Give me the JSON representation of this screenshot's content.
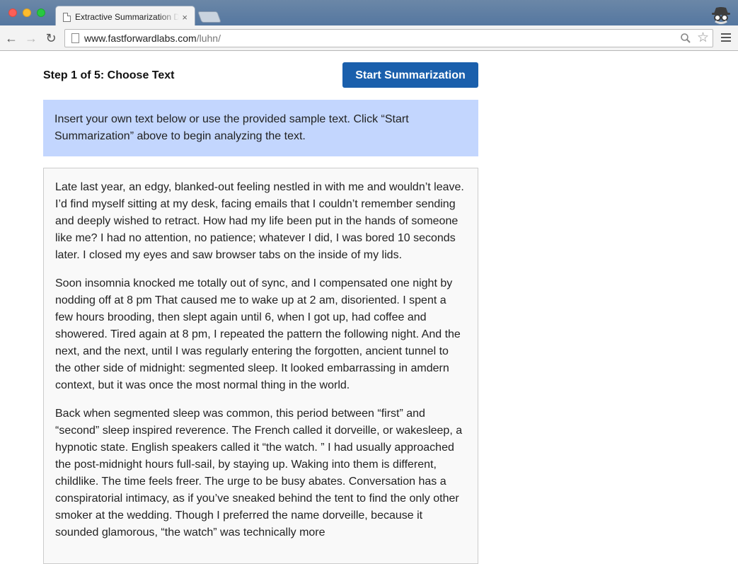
{
  "browser": {
    "tab_title": "Extractive Summarization D",
    "tab_close": "×",
    "url_domain": "www.fastforwardlabs.com",
    "url_path": "/luhn/",
    "back_glyph": "←",
    "forward_glyph": "→",
    "reload_glyph": "↻",
    "star_glyph": "☆"
  },
  "header": {
    "step_title": "Step 1 of 5: Choose Text",
    "start_button": "Start Summarization"
  },
  "info": {
    "text": "Insert your own text below or use the provided sample text. Click “Start Summarization” above to begin analyzing the text."
  },
  "sample_text": {
    "paragraphs": [
      "Late last year, an edgy, blanked-out feeling nestled in with me and wouldn’t leave. I’d find myself sitting at my desk, facing emails that I couldn’t remember sending and deeply wished to retract. How had my life been put in the hands of someone like me? I had no attention, no patience; whatever I did, I was bored 10 seconds later. I closed my eyes and saw browser tabs on the inside of my lids.",
      "Soon insomnia knocked me totally out of sync, and I compensated one night by nodding off at 8 pm That caused me to wake up at 2 am, disoriented. I spent a few hours brooding, then slept again until 6, when I got up, had coffee and showered. Tired again at 8 pm, I repeated the pattern the following night. And the next, and the next, until I was regularly entering the forgotten, ancient tunnel to the other side of midnight: segmented sleep. It looked embarrassing in amdern context, but it was once the most normal thing in the world.",
      "Back when segmented sleep was common, this period between “first” and “second” sleep inspired reverence. The French called it dorveille, or wakesleep, a hypnotic state. English speakers called it “the watch. ” I had usually approached the post-midnight hours full-sail, by staying up. Waking into them is different, childlike. The time feels freer. The urge to be busy abates. Conversation has a conspiratorial intimacy, as if you’ve sneaked behind the tent to find the only other smoker at the wedding. Though I preferred the name dorveille, because it sounded glamorous, “the watch” was technically more"
    ]
  },
  "colors": {
    "button_bg": "#1a5fac",
    "info_bg": "#c3d6fe",
    "text_area_bg": "#f9f9f9"
  },
  "icons": {
    "tab_page": "document-icon",
    "incognito": "incognito-icon",
    "search": "search-icon",
    "bookmark": "star-icon",
    "menu": "hamburger-menu-icon"
  }
}
